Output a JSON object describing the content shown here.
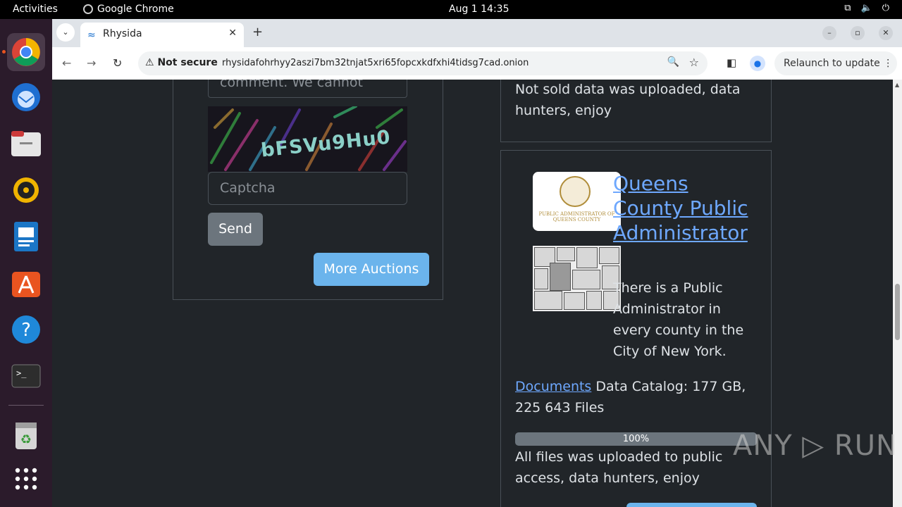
{
  "topbar": {
    "activities": "Activities",
    "app_name": "Google Chrome",
    "clock": "Aug 1  14:35"
  },
  "browser": {
    "tab_title": "Rhysida",
    "security_label": "Not secure",
    "url": "rhysidafohrhyy2aszi7bm32tnjat5xri65fopcxkdfxhi4tidsg7cad.onion",
    "relaunch_label": "Relaunch to update"
  },
  "left_card": {
    "comment_partial": "comment. We cannot",
    "captcha_code": "bFSVu9Hu0",
    "captcha_placeholder": "Captcha",
    "send_label": "Send",
    "more_label": "More Auctions"
  },
  "right_cards": {
    "prev_status": "Not sold data was uploaded, data hunters, enjoy",
    "title": "Queens County Public Administrator",
    "logo_caption": "PUBLIC ADMINISTRATOR OF QUEENS COUNTY",
    "description": "There is a Public Administrator in every county in the City of New York.",
    "documents_link": "Documents",
    "catalog_text": " Data Catalog: 177 GB, 225 643 Files",
    "progress_label": "100%",
    "progress_fraction": 1.0,
    "status": "All files was uploaded to public access, data hunters, enjoy"
  },
  "watermark": "ANY ▷ RUN"
}
